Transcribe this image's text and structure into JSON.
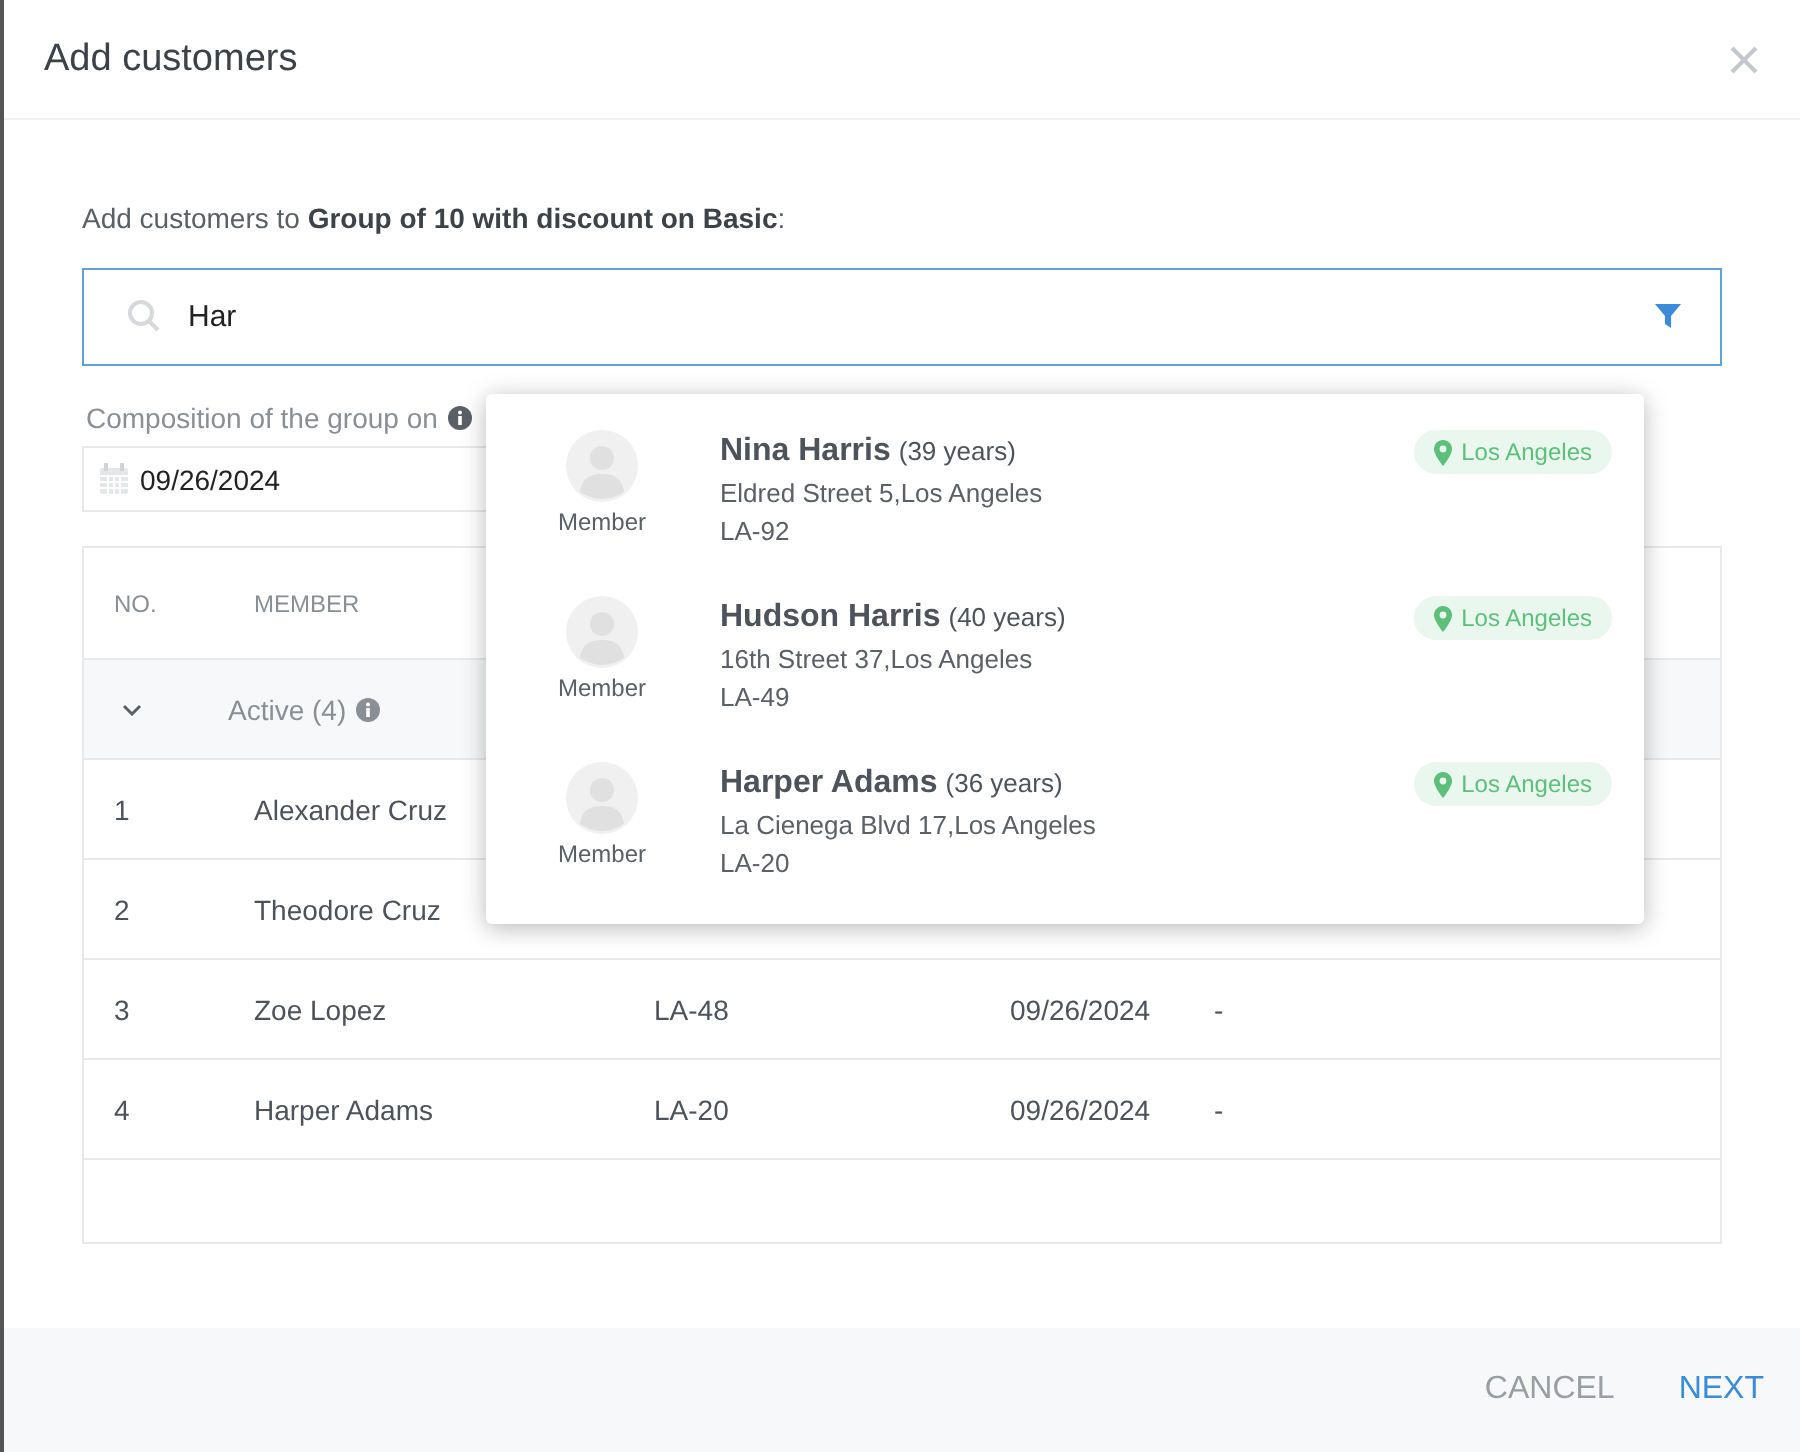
{
  "dialog": {
    "title": "Add customers"
  },
  "intro": "Add customers to **Group of 10 with discount on Basic**:",
  "search": {
    "value": "Har"
  },
  "composition": {
    "label": "Composition of the group on",
    "date": "09/26/2024"
  },
  "table": {
    "columns": [
      "NO.",
      "MEMBER"
    ],
    "group": {
      "label": "Active (4)",
      "expanded": true
    },
    "rows": [
      {
        "no": "1",
        "member": "Alexander Cruz",
        "column_3": "",
        "column_4": "",
        "column_5": ""
      },
      {
        "no": "2",
        "member": "Theodore Cruz",
        "column_3": "",
        "column_4": "",
        "column_5": ""
      },
      {
        "no": "3",
        "member": "Zoe Lopez",
        "column_3": "LA-48",
        "column_4": "09/26/2024",
        "column_5": "-"
      },
      {
        "no": "4",
        "member": "Harper Adams",
        "column_3": "LA-20",
        "column_4": "09/26/2024",
        "column_5": "-"
      }
    ]
  },
  "suggestions": [
    {
      "role": "Member",
      "name": "Nina Harris",
      "age": "(39 years)",
      "address": "Eldred Street 5,Los Angeles",
      "code": "LA-92",
      "location": "Los Angeles"
    },
    {
      "role": "Member",
      "name": "Hudson Harris",
      "age": "(40 years)",
      "address": "16th Street 37,Los Angeles",
      "code": "LA-49",
      "location": "Los Angeles"
    },
    {
      "role": "Member",
      "name": "Harper Adams",
      "age": "(36 years)",
      "address": "La Cienega Blvd 17,Los Angeles",
      "code": "LA-20",
      "location": "Los Angeles"
    }
  ],
  "buttons": [
    {
      "label": "CANCEL",
      "kind": "secondary"
    },
    {
      "label": "NEXT",
      "kind": "primary"
    }
  ]
}
